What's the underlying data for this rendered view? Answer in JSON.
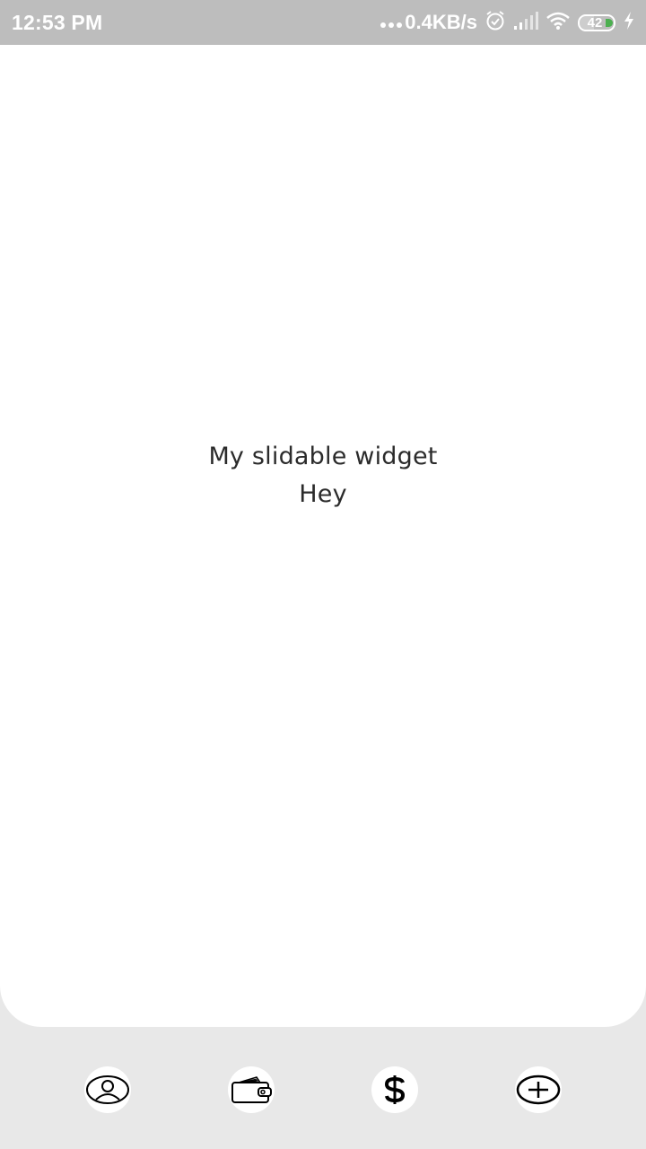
{
  "status_bar": {
    "time": "12:53 PM",
    "net_speed": "0.4KB/s",
    "battery_level": "42",
    "battery_percent": 0.42,
    "icons": [
      "alarm-icon",
      "signal-icon",
      "wifi-icon",
      "battery-icon",
      "charging-icon"
    ]
  },
  "main": {
    "title": "My slidable widget",
    "subtitle": "Hey"
  },
  "bottom_nav": {
    "items": [
      {
        "icon": "profile-icon"
      },
      {
        "icon": "wallet-icon"
      },
      {
        "icon": "dollar-icon"
      },
      {
        "icon": "add-circle-icon"
      }
    ]
  },
  "colors": {
    "status_bar_bg": "#bdbdbd",
    "panel_bg": "#ffffff",
    "page_bg": "#e8e8e8",
    "battery_accent": "#4caf50"
  }
}
